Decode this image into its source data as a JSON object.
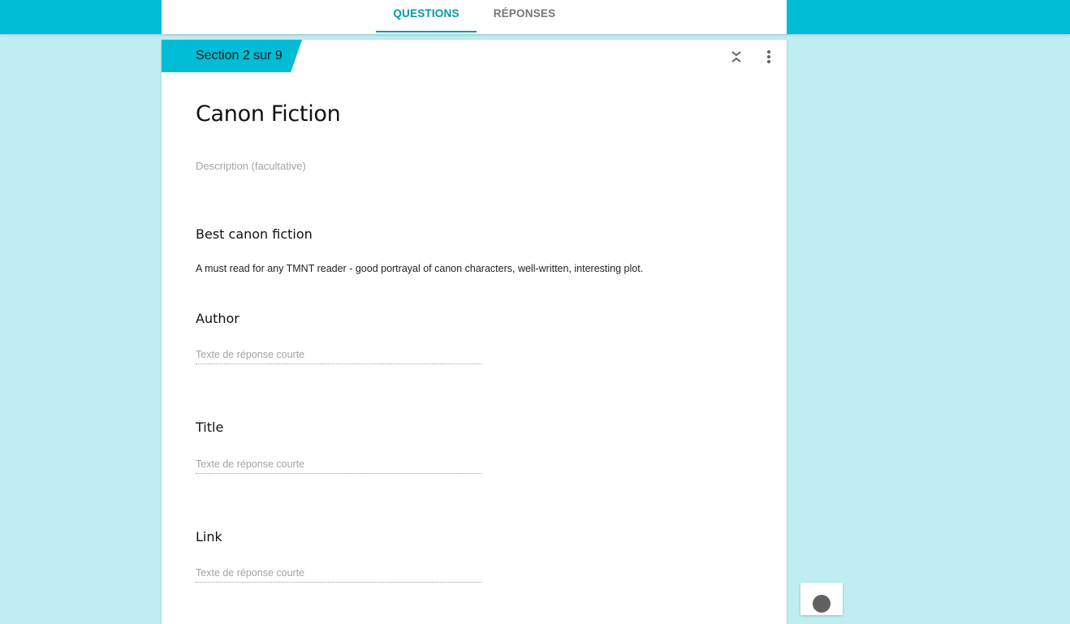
{
  "tabs": {
    "questions": "QUESTIONS",
    "responses": "RÉPONSES"
  },
  "section": {
    "label": "Section 2 sur 9",
    "title": "Canon Fiction",
    "description_placeholder": "Description (facultative)"
  },
  "questions": [
    {
      "title": "Best canon fiction",
      "description": "A must read for any TMNT reader - good portrayal of canon characters, well-written, interesting plot."
    },
    {
      "title": "Author",
      "answer_placeholder": "Texte de réponse courte"
    },
    {
      "title": "Title",
      "answer_placeholder": "Texte de réponse courte"
    },
    {
      "title": "Link",
      "answer_placeholder": "Texte de réponse courte"
    }
  ],
  "icons": {
    "collapse": "collapse-icon",
    "more": "more-vert-icon",
    "add": "add-circle-icon"
  },
  "colors": {
    "accent": "#00bcd4",
    "tab_active": "#0097a7",
    "background": "#beedf2"
  }
}
